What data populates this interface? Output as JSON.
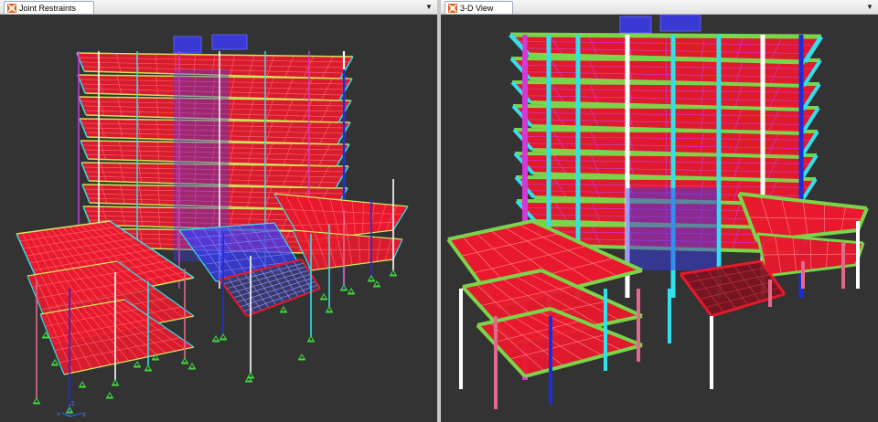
{
  "left_pane": {
    "tab_title": "Joint Restraints",
    "tab_icon": "etabs-model-icon",
    "dropdown_icon": "chevron-down-icon",
    "dropdown_glyph": "▼",
    "view": "joint-restraints-3d-model"
  },
  "right_pane": {
    "tab_title": "3-D View",
    "tab_icon": "etabs-model-icon",
    "dropdown_icon": "chevron-down-icon",
    "dropdown_glyph": "▼",
    "view": "extruded-3d-model"
  },
  "colors": {
    "viewport_bg": "#333333",
    "slab": "#e8192c",
    "slab_grid": "#ff5a6a",
    "beam_green": "#7cd44a",
    "beam_cyan": "#31e0ea",
    "column_blue": "#1d2dd8",
    "column_white": "#f2f2f2",
    "column_pink": "#e06a8a",
    "column_magenta": "#d13ad6",
    "restraint_green": "#3fdc3f",
    "core_blue": "#3a3cf0"
  },
  "axis_labels": {
    "z": "Z",
    "x": "X",
    "y": "Y"
  }
}
